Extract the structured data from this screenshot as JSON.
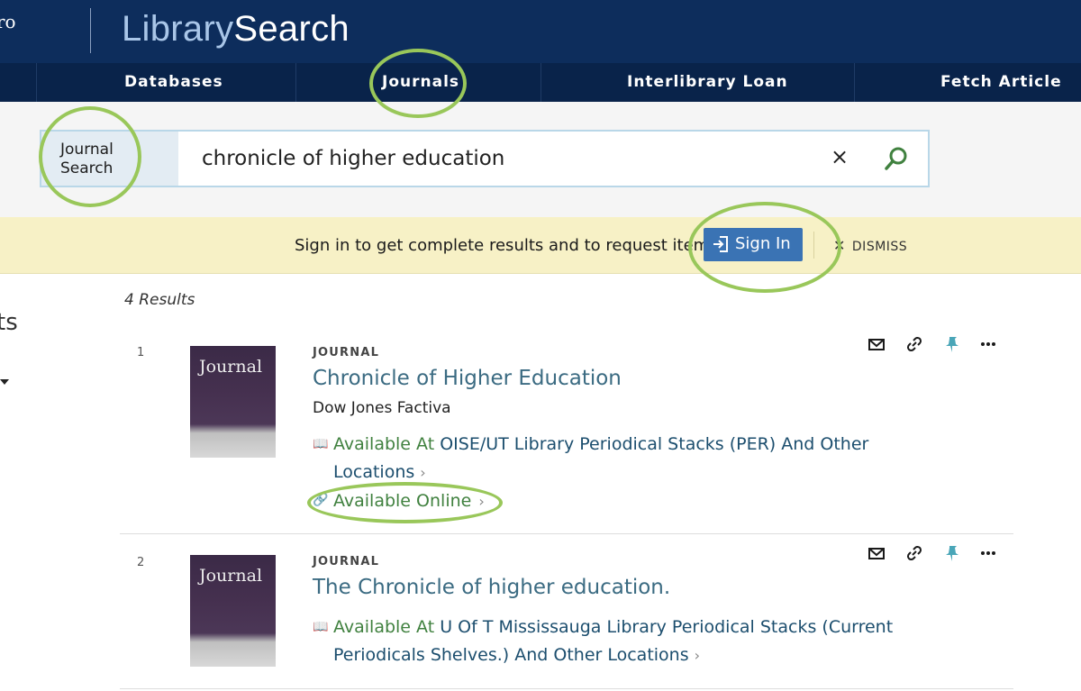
{
  "header": {
    "logo_fragment": "ro",
    "app_title_part1": "Library",
    "app_title_part2": "Search",
    "nav": [
      {
        "label": "Databases"
      },
      {
        "label": "Journals"
      },
      {
        "label": "Interlibrary Loan"
      },
      {
        "label": "Fetch Article"
      }
    ]
  },
  "search": {
    "scope_label": "Journal Search",
    "query": "chronicle of higher education",
    "clear_label": "×"
  },
  "banner": {
    "message": "Sign in to get complete results and to request items",
    "signin_label": "Sign In",
    "dismiss_label": "DISMISS"
  },
  "facets": {
    "fragment": "ts"
  },
  "results": {
    "count": "4 Results",
    "items": [
      {
        "number": "1",
        "thumb_label": "Journal",
        "type": "JOURNAL",
        "title": "Chronicle of Higher Education",
        "publisher": "Dow Jones Factiva",
        "availability_prefix": "Available At",
        "location": "OISE/UT Library  Periodical Stacks (PER)",
        "other": "And Other Locations",
        "online": "Available Online"
      },
      {
        "number": "2",
        "thumb_label": "Journal",
        "type": "JOURNAL",
        "title": "The Chronicle of higher education.",
        "availability_prefix": "Available At",
        "location": "U Of T Mississauga Library  Periodical Stacks (Current Periodicals Shelves.)",
        "other": "And Other Locations"
      }
    ]
  },
  "colors": {
    "header_bg": "#0d2d5c",
    "nav_bg": "#09234a",
    "banner_bg": "#f7f1c6",
    "signin_bg": "#3a73b4",
    "available_green": "#40813f",
    "title_blue": "#3b6b82",
    "annotation_green": "#99c75a"
  }
}
